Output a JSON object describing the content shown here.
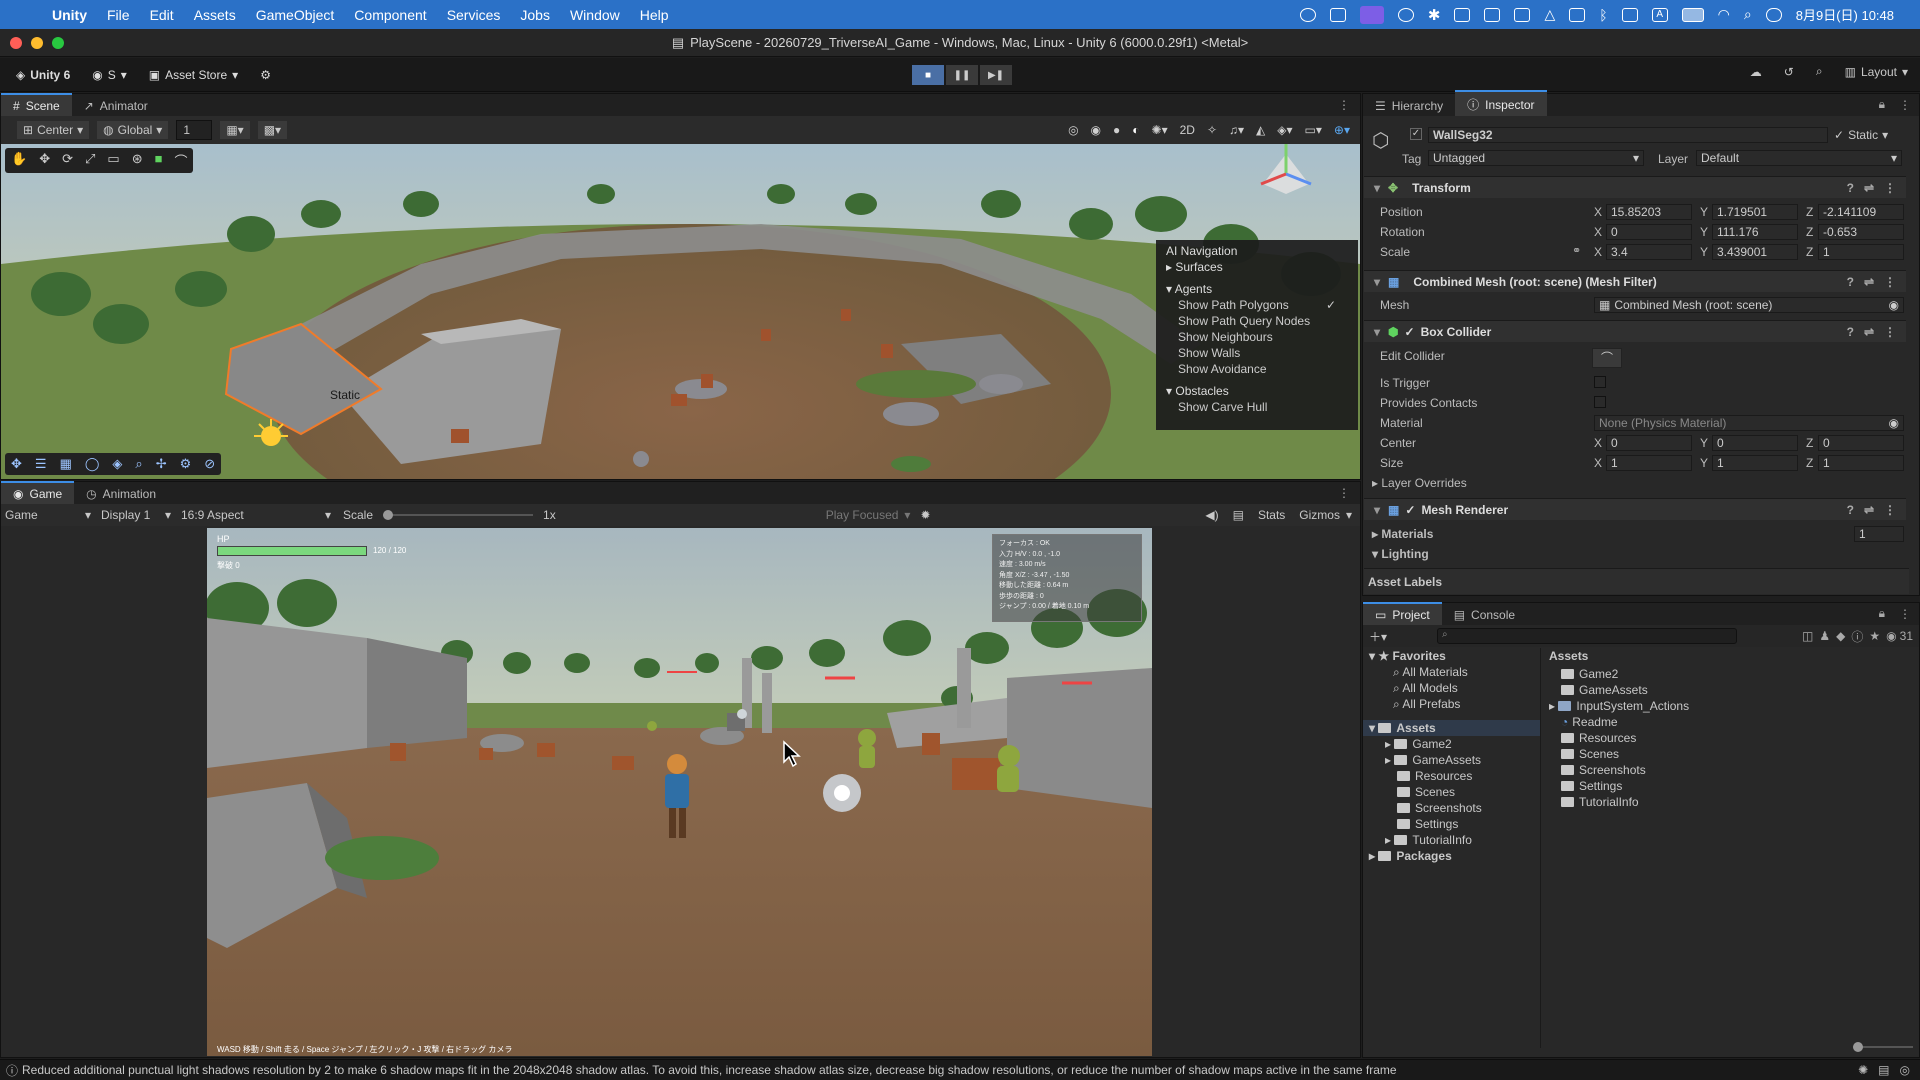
{
  "macos_menubar": {
    "app": "Unity",
    "menus": [
      "File",
      "Edit",
      "Assets",
      "GameObject",
      "Component",
      "Services",
      "Jobs",
      "Window",
      "Help"
    ],
    "date_time": "8月9日(日) 10:48"
  },
  "window": {
    "title": "PlayScene - 20260729_TriverseAI_Game - Windows, Mac, Linux - Unity 6 (6000.0.29f1) <Metal>"
  },
  "toolbar": {
    "account": "Unity 6",
    "user": "S",
    "asset_store": "Asset Store",
    "layout": "Layout",
    "play_state": "playing"
  },
  "scene_panel": {
    "tabs": [
      "Scene",
      "Animator"
    ],
    "pivot": "Center",
    "space": "Global",
    "grid_snap": "1",
    "static_label": "Static",
    "overlay": {
      "title": "AI Navigation",
      "sections": [
        "Surfaces",
        "Agents",
        "Obstacles"
      ],
      "agent_items": [
        "Show Path Polygons",
        "Show Path Query Nodes",
        "Show Neighbours",
        "Show Walls",
        "Show Avoidance"
      ],
      "obstacle_items": [
        "Show Carve Hull"
      ]
    }
  },
  "game_panel": {
    "tabs": [
      "Game",
      "Animation"
    ],
    "display_mode": "Game",
    "display": "Display 1",
    "aspect": "16:9 Aspect",
    "scale_label": "Scale",
    "scale_value": "1x",
    "play_mode": "Play Focused",
    "stats": "Stats",
    "gizmos": "Gizmos",
    "hud": {
      "hp_label": "HP",
      "hp_value": "120 / 120",
      "hp_fraction": 1.0,
      "second_label": "撃破 0",
      "debug_lines": [
        "フォーカス : OK",
        "入力 H/V : 0.0 , -1.0",
        "速度 : 3.00 m/s",
        "角度 X/Z : -3.47 , -1.50",
        "移動した距離 : 0.64 m",
        "歩歩の距離 : 0",
        "ジャンプ : 0.00 / 着地 0.10 m"
      ],
      "controls": "WASD 移動 / Shift 走る / Space ジャンプ / 左クリック・J 攻撃 / 右ドラッグ カメラ"
    }
  },
  "inspector": {
    "tabs": [
      "Hierarchy",
      "Inspector"
    ],
    "object_name": "WallSeg32",
    "static": "Static",
    "tag_label": "Tag",
    "tag": "Untagged",
    "layer_label": "Layer",
    "layer": "Default",
    "transform": {
      "title": "Transform",
      "position": {
        "label": "Position",
        "x": "15.85203",
        "y": "1.719501",
        "z": "-2.141109"
      },
      "rotation": {
        "label": "Rotation",
        "x": "0",
        "y": "111.176",
        "z": "-0.653"
      },
      "scale": {
        "label": "Scale",
        "x": "3.4",
        "y": "3.439001",
        "z": "1"
      }
    },
    "mesh_filter": {
      "title": "Combined Mesh (root: scene) (Mesh Filter)",
      "mesh_label": "Mesh",
      "mesh": "Combined Mesh (root: scene)"
    },
    "box_collider": {
      "title": "Box Collider",
      "edit_collider": "Edit Collider",
      "is_trigger": "Is Trigger",
      "provides_contacts": "Provides Contacts",
      "material_label": "Material",
      "material": "None (Physics Material)",
      "center": {
        "label": "Center",
        "x": "0",
        "y": "0",
        "z": "0"
      },
      "size": {
        "label": "Size",
        "x": "1",
        "y": "1",
        "z": "1"
      },
      "layer_overrides": "Layer Overrides"
    },
    "mesh_renderer": {
      "title": "Mesh Renderer",
      "materials": "Materials",
      "materials_count": "1",
      "lighting": "Lighting"
    },
    "asset_labels": "Asset Labels"
  },
  "project": {
    "tabs": [
      "Project",
      "Console"
    ],
    "count": "31",
    "favorites": {
      "label": "Favorites",
      "items": [
        "All Materials",
        "All Models",
        "All Prefabs"
      ]
    },
    "assets_tree": {
      "label": "Assets",
      "items": [
        "Game2",
        "GameAssets",
        "Resources",
        "Scenes",
        "Screenshots",
        "Settings",
        "TutorialInfo"
      ]
    },
    "packages": "Packages",
    "assets_header": "Assets",
    "assets_list": [
      "Game2",
      "GameAssets",
      "InputSystem_Actions",
      "Readme",
      "Resources",
      "Scenes",
      "Screenshots",
      "Settings",
      "TutorialInfo"
    ]
  },
  "status": {
    "message": "Reduced additional punctual light shadows resolution by 2 to make 6 shadow maps fit in the 2048x2048 shadow atlas. To avoid this, increase shadow atlas size, decrease big shadow resolutions, or reduce the number of shadow maps active in the same frame"
  },
  "colors": {
    "accent": "#3d8ee6",
    "menubar": "#2b71c7",
    "hp_bar": "#7bd87e"
  }
}
